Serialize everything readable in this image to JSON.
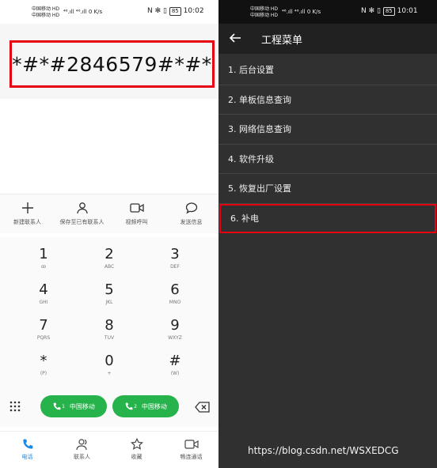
{
  "left": {
    "status": {
      "carrier1": "中国移动 HD",
      "carrier2": "中国移动 HD",
      "signal": "⁴⁶.ıll ⁴⁶.ıll",
      "speed": "0 K/s",
      "right_icons": "N ✻ ▯",
      "battery": "85",
      "time": "10:02"
    },
    "dialed": "*#*#2846579#*#*",
    "actions": [
      {
        "label": "新建联系人",
        "icon": "plus-icon"
      },
      {
        "label": "保存至已有联系人",
        "icon": "person-icon"
      },
      {
        "label": "视频呼叫",
        "icon": "video-icon"
      },
      {
        "label": "发送信息",
        "icon": "message-icon"
      }
    ],
    "keys": [
      {
        "d": "1",
        "s": "ꝏ"
      },
      {
        "d": "2",
        "s": "ABC"
      },
      {
        "d": "3",
        "s": "DEF"
      },
      {
        "d": "4",
        "s": "GHI"
      },
      {
        "d": "5",
        "s": "JKL"
      },
      {
        "d": "6",
        "s": "MNO"
      },
      {
        "d": "7",
        "s": "PQRS"
      },
      {
        "d": "8",
        "s": "TUV"
      },
      {
        "d": "9",
        "s": "WXYZ"
      },
      {
        "d": "*",
        "s": "(P)"
      },
      {
        "d": "0",
        "s": "+"
      },
      {
        "d": "#",
        "s": "(W)"
      }
    ],
    "call1": {
      "label": "中国移动",
      "sim": "1"
    },
    "call2": {
      "label": "中国移动",
      "sim": "2"
    },
    "nav": [
      {
        "label": "电话",
        "icon": "phone-icon",
        "active": true
      },
      {
        "label": "联系人",
        "icon": "contacts-icon",
        "active": false
      },
      {
        "label": "收藏",
        "icon": "star-icon",
        "active": false
      },
      {
        "label": "畅连通话",
        "icon": "video-call-icon",
        "active": false
      }
    ]
  },
  "right": {
    "status": {
      "carrier1": "中国移动 HD",
      "carrier2": "中国移动 HD",
      "signal": "⁴⁶.ıll ⁴⁶.ıll",
      "speed": "0 K/s",
      "right_icons": "N ✻ ▯",
      "battery": "85",
      "time": "10:01"
    },
    "title": "工程菜单",
    "menu": [
      "1. 后台设置",
      "2. 单板信息查询",
      "3. 网络信息查询",
      "4. 软件升级",
      "5. 恢复出厂设置",
      "6. 补电"
    ],
    "watermark": "https://blog.csdn.net/WSXEDCG"
  },
  "colors": {
    "highlight": "#e60012",
    "call_green": "#27b34b",
    "accent": "#1e88e5"
  }
}
